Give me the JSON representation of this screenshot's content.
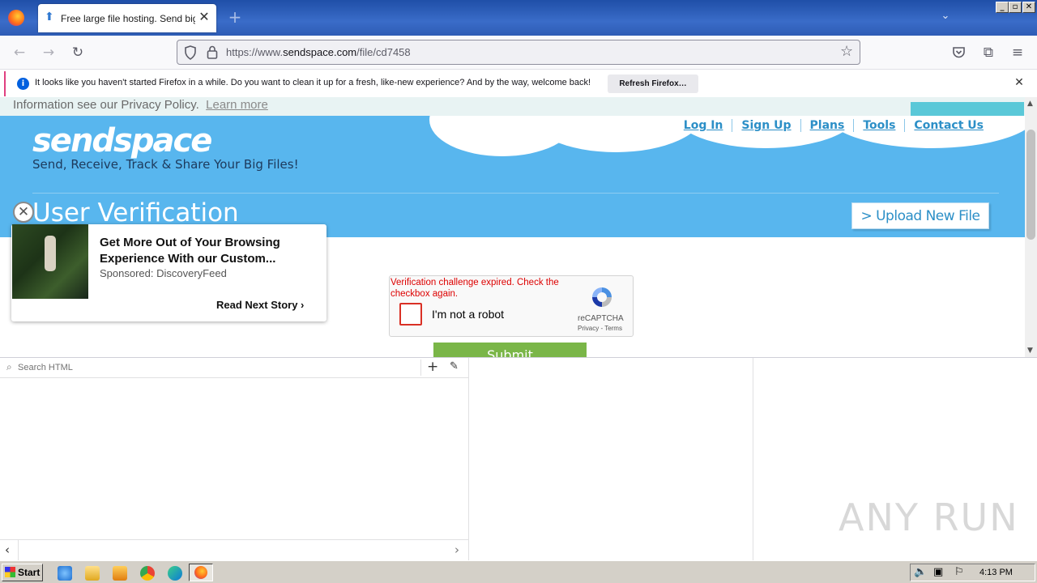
{
  "browser": {
    "tab_title": "Free large file hosting. Send big file",
    "url_prefix": "https://www.",
    "url_domain": "sendspace.com",
    "url_path": "/file/cd7458",
    "win_controls": [
      "_",
      "▫",
      "✕"
    ]
  },
  "notification": {
    "text": "It looks like you haven't started Firefox in a while. Do you want to clean it up for a fresh, like-new experience? And by the way, welcome back!",
    "button": "Refresh Firefox…"
  },
  "page": {
    "cookie_text": "Information see our Privacy Policy.",
    "cookie_link": "Learn more",
    "logo": "sendspace",
    "tagline": "Send, Receive, Track & Share Your Big Files!",
    "nav": [
      "Log In",
      "Sign Up",
      "Plans",
      "Tools",
      "Contact Us"
    ],
    "heading": "User Verification",
    "upload_button": "> Upload New File",
    "submit": "Submit"
  },
  "ad": {
    "title": "Get More Out of Your Browsing Experience With our Custom...",
    "sponsor": "Sponsored: DiscoveryFeed",
    "cta": "Read Next Story"
  },
  "recaptcha": {
    "error": "Verification challenge expired. Check the checkbox again.",
    "label": "I'm not a robot",
    "brand": "reCAPTCHA",
    "links": "Privacy - Terms"
  },
  "devtools": {
    "search_placeholder": "Search HTML",
    "watermark": "ANY RUN"
  },
  "taskbar": {
    "start": "Start",
    "clock": "4:13 PM"
  },
  "colors": {
    "hero": "#58b6ee",
    "link": "#2c8fc7",
    "submit": "#7ab648",
    "error": "#dd0000"
  }
}
